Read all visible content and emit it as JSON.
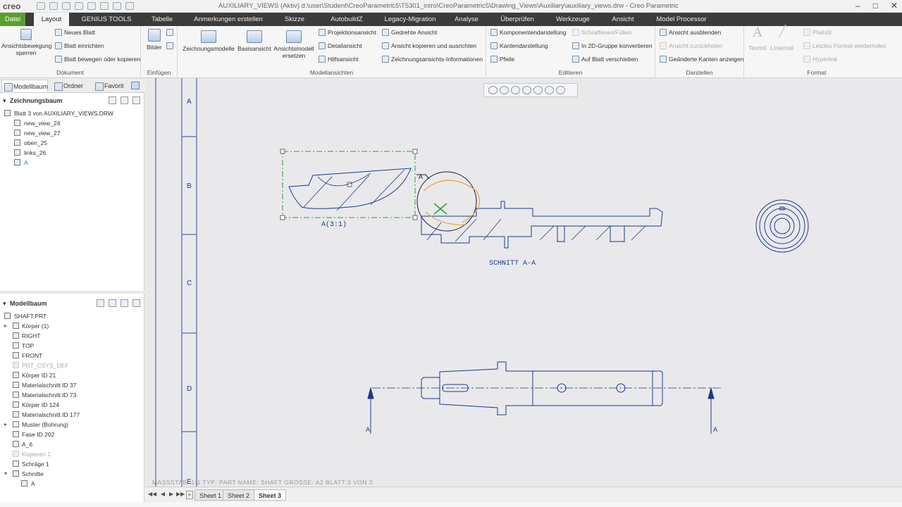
{
  "app": {
    "logo": "creo",
    "window_title": "AUXILIARY_VIEWS (Aktiv) d:\\user\\Student\\CreoParametric5\\T5301_intro\\CreoParametric5\\Drawing_Views\\Auxiliary\\auxiliary_views.drw - Creo Parametric"
  },
  "tabs": [
    "Datei",
    "Layout",
    "GENIUS TOOLS",
    "Tabelle",
    "Anmerkungen erstellen",
    "Skizze",
    "AutobuildZ",
    "Legacy-Migration",
    "Analyse",
    "Überprüfen",
    "Werkzeuge",
    "Ansicht",
    "Model Processor"
  ],
  "ribbon": {
    "dokument": {
      "label": "Dokument",
      "big": "Ansichtsbewegung sperren",
      "items": [
        "Neues Blatt",
        "Blatt einrichten",
        "Blatt bewegen oder kopieren"
      ]
    },
    "einfuegen": {
      "label": "Einfügen",
      "big": "Bilder"
    },
    "modellansichten": {
      "label": "Modellansichten",
      "big": [
        "Zeichnungsmodelle",
        "Basisansicht",
        "Ansichtsmodell ersetzen"
      ],
      "col1": [
        "Projektionsansicht",
        "Detailansicht",
        "Hilfsansicht"
      ],
      "col2": [
        "Gedrehte Ansicht",
        "Ansicht kopieren und ausrichten",
        "Zeichnungsansichts-Informationen"
      ]
    },
    "editieren": {
      "label": "Editieren",
      "col1": [
        "Komponentendarstellung",
        "Kantendarstellung",
        "Pfeile"
      ],
      "col2": [
        "Schraffieren/Füllen",
        "In 2D-Gruppe konvertieren",
        "Auf Blatt verschieben"
      ]
    },
    "darstellen": {
      "label": "Darstellen",
      "items": [
        "Ansicht ausblenden",
        "Ansicht zurückholen",
        "Geänderte Kanten anzeigen"
      ]
    },
    "format": {
      "label": "Format",
      "big": [
        "Textstil",
        "Linienstil"
      ],
      "items": [
        "Pfeilstil",
        "Letztes Format wiederholen",
        "Hyperlink"
      ]
    }
  },
  "sidebar": {
    "tabs": [
      "Modellbaum",
      "Ordner",
      "Favorit"
    ],
    "drawing_tree": {
      "title": "Zeichnungsbaum",
      "items": [
        "Blatt 3 von AUXILIARY_VIEWS.DRW",
        "new_view_24",
        "new_view_27",
        "oben_25",
        "links_26",
        "A"
      ]
    },
    "model_tree": {
      "title": "Modellbaum",
      "items": [
        "SHAFT.PRT",
        "Körper (1)",
        "RIGHT",
        "TOP",
        "FRONT",
        "PRT_CSYS_DEF",
        "Körper ID 21",
        "Materialschnitt ID 37",
        "Materialschnitt ID 73",
        "Körper ID 124",
        "Materialschnitt ID 177",
        "Muster (Bohrung)",
        "Fase ID 202",
        "A_6",
        "Kopieren 1",
        "Schräge 1",
        "Schnitte",
        "A"
      ]
    }
  },
  "drawing": {
    "zones": [
      "A",
      "B",
      "C",
      "D",
      "E"
    ],
    "detail_label": "A(3:1)",
    "section_label": "SCHNITT  A-A",
    "circle_label": "A",
    "arrow_labels": [
      "A",
      "A"
    ]
  },
  "footer": {
    "meta": "MASSSTAB: 1:1    TYP: PART    NAME: SHAFT    GRÖSSE: A2    BLATT 3  VON 3"
  },
  "sheets": [
    "Sheet 1",
    "Sheet 2",
    "Sheet 3"
  ],
  "colors": {
    "file_tab": "#5aa02c",
    "geometry": "#1a3a8c",
    "selection": "#2aa02c",
    "highlight": "#e8a030"
  }
}
